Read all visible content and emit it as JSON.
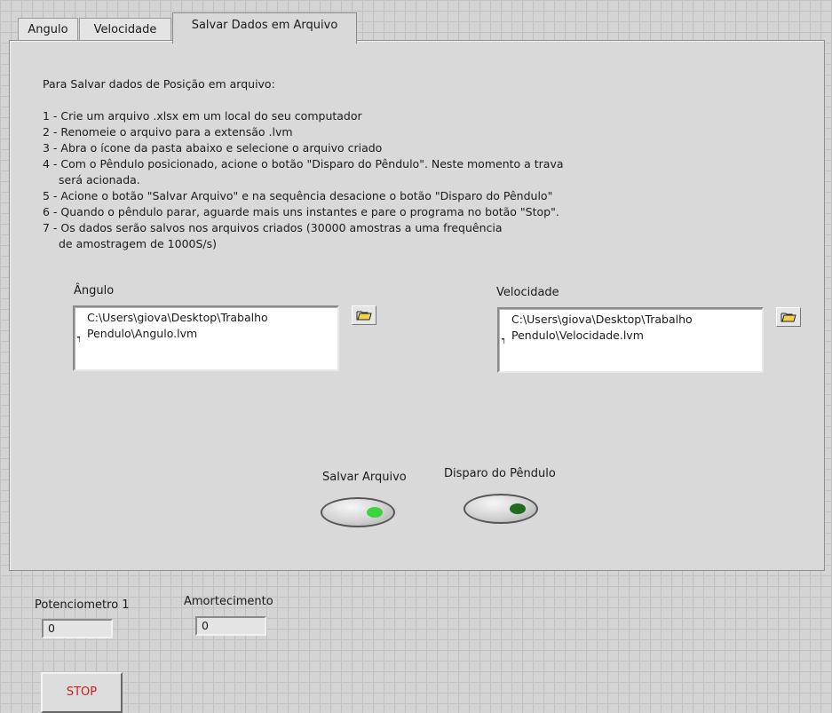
{
  "tabs": [
    {
      "label": "Angulo",
      "active": false
    },
    {
      "label": "Velocidade",
      "active": false
    },
    {
      "label": "Salvar Dados em Arquivo",
      "active": true
    }
  ],
  "instructions": {
    "heading": "Para Salvar dados de Posição em arquivo:",
    "lines": [
      "1 - Crie um arquivo .xlsx em um local do seu computador",
      "2 - Renomeie o arquivo para a extensão .lvm",
      "3 - Abra o ícone da pasta abaixo e selecione o arquivo criado",
      "4 - Com o Pêndulo posicionado, acione o botão \"Disparo do Pêndulo\". Neste momento a trava",
      "será acionada.",
      "5 - Acione o botão \"Salvar Arquivo\" e na sequência desacione o botão \"Disparo do Pêndulo\"",
      "6 - Quando o pêndulo parar, aguarde mais uns instantes e pare o programa no botão \"Stop\".",
      "7 - Os dados serão salvos nos arquivos  criados  (30000 amostras a uma  frequência",
      "de amostragem de 1000S/s)"
    ]
  },
  "file_paths": {
    "angulo": {
      "label": "Ângulo",
      "value": "C:\\Users\\giova\\Desktop\\Trabalho\nPendulo\\Angulo.lvm",
      "browse_icon": "folder-open-icon"
    },
    "velocidade": {
      "label": "Velocidade",
      "value": "C:\\Users\\giova\\Desktop\\Trabalho\nPendulo\\Velocidade.lvm",
      "browse_icon": "folder-open-icon"
    }
  },
  "buttons": {
    "salvar_arquivo": {
      "label": "Salvar Arquivo",
      "led_color": "#3cd43c"
    },
    "disparo_pendulo": {
      "label": "Disparo do Pêndulo",
      "led_color": "#1f6b1f"
    }
  },
  "indicators": {
    "potenciometro": {
      "label": "Potenciometro 1",
      "value": "0"
    },
    "amortecimento": {
      "label": "Amortecimento",
      "value": "0"
    }
  },
  "stop_button": {
    "label": "STOP",
    "color": "#d21a1a"
  }
}
